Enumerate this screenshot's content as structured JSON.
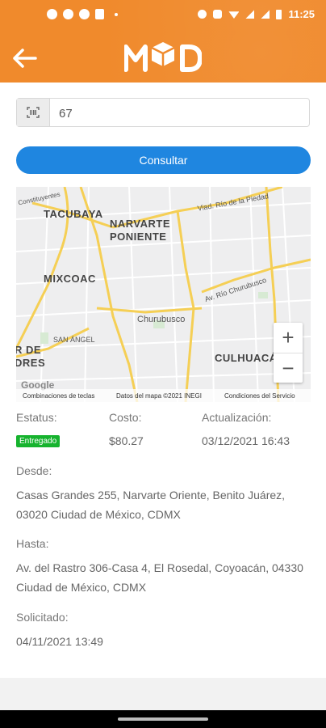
{
  "status_bar": {
    "time": "11:25"
  },
  "app": {
    "logo_text": "MYD"
  },
  "search": {
    "value": "67",
    "placeholder": ""
  },
  "actions": {
    "consult": "Consultar"
  },
  "map": {
    "labels": [
      "TACUBAYA",
      "NARVARTE",
      "PONIENTE",
      "MIXCOAC",
      "CULHUACÁN",
      "Churubusco",
      "SAN ÁNGEL",
      "R DE",
      "DRES"
    ],
    "roads": [
      "Viad. Río de la Piedad",
      "Av. Río Churubusco",
      "Constituyentes"
    ],
    "footer": [
      "Combinaciones de teclas",
      "Datos del mapa ©2021 INEGI",
      "Condiciones del Servicio"
    ],
    "attribution": "Google"
  },
  "details": {
    "estatus_label": "Estatus:",
    "estatus_value": "Entregado",
    "costo_label": "Costo:",
    "costo_value": "$80.27",
    "actualizacion_label": "Actualización:",
    "actualizacion_value": "03/12/2021 16:43",
    "desde_label": "Desde:",
    "desde_value": "Casas Grandes 255, Narvarte Oriente, Benito Juárez, 03020 Ciudad de México, CDMX",
    "hasta_label": "Hasta:",
    "hasta_value": "Av. del Rastro 306-Casa 4, El Rosedal, Coyoacán, 04330 Ciudad de México, CDMX",
    "solicitado_label": "Solicitado:",
    "solicitado_value": "04/11/2021 13:49"
  },
  "colors": {
    "primary": "#f08a2c",
    "button": "#1f86e0",
    "badge": "#16b32e"
  }
}
